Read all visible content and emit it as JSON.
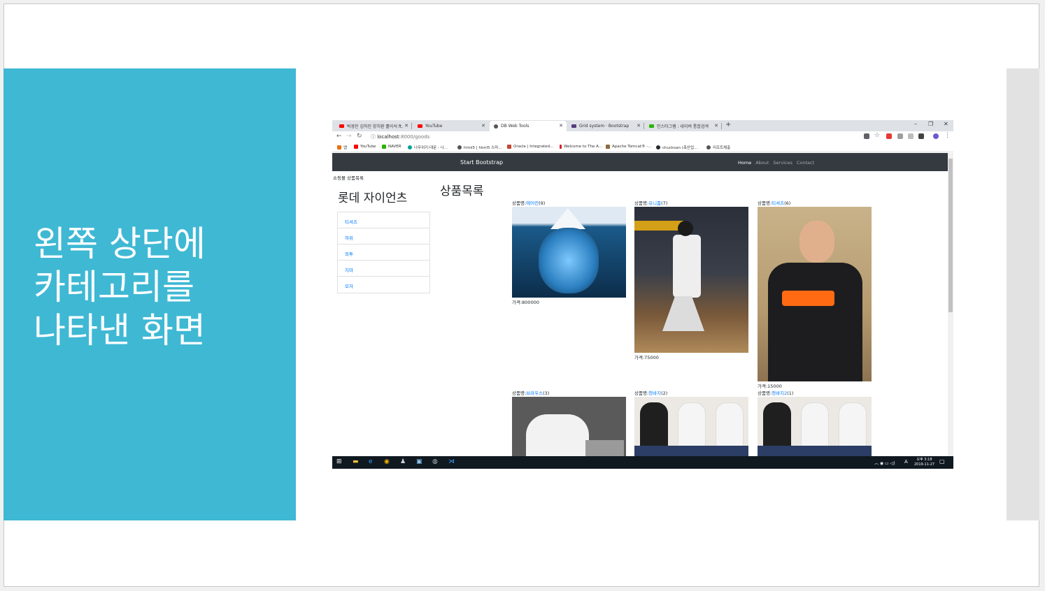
{
  "slide": {
    "title_lines": [
      "왼쪽 상단에",
      "카테고리를",
      "나타낸 화면"
    ],
    "band_color": "#3fb8d4"
  },
  "browser": {
    "tabs": [
      {
        "label": "박경진 김하진 양치환 홀이석 ft.",
        "favicon_color": "#ff0000"
      },
      {
        "label": "YouTube",
        "favicon_color": "#ff0000"
      },
      {
        "label": "DB Web Tools",
        "favicon_color": "#555555",
        "active": true
      },
      {
        "label": "Grid system · Bootstrap",
        "favicon_color": "#563d7c"
      },
      {
        "label": "인스타그램 : 네이버 통합검색",
        "favicon_color": "#2db400"
      }
    ],
    "new_tab": "+",
    "window_controls": [
      "–",
      "❐",
      "✕"
    ],
    "url_host": "localhost",
    "url_path": ":8000/goods",
    "bookmarks": [
      {
        "label": "앱",
        "color": "#e8710a"
      },
      {
        "label": "YouTube",
        "color": "#ff0000"
      },
      {
        "label": "NAVER",
        "color": "#2db400"
      },
      {
        "label": "나무위키:대문 - 나...",
        "color": "#00a495"
      },
      {
        "label": "html5 | html5 스마...",
        "color": "#555555"
      },
      {
        "label": "Oracle | Integrated...",
        "color": "#c74634"
      },
      {
        "label": "Welcome to The A...",
        "color": "#d22128"
      },
      {
        "label": "Apache Tomcat® -...",
        "color": "#8a6d3b"
      },
      {
        "label": "chucksan (축산업...",
        "color": "#24292e"
      },
      {
        "label": "리프트체출",
        "color": "#555555"
      }
    ]
  },
  "site": {
    "brand": "Start Bootstrap",
    "nav": [
      "Home",
      "About",
      "Services",
      "Contact"
    ],
    "breadcrumb": "쇼핑몰 상품목록",
    "store_title": "롯데 자이언츠",
    "categories": [
      "티셔츠",
      "하위",
      "외투",
      "지마",
      "모자"
    ],
    "section_title": "상품목록",
    "name_prefix": "상품명:",
    "price_prefix": "가격:",
    "products": [
      {
        "name": "에어컨",
        "count": "(9)",
        "price": "800000"
      },
      {
        "name": "유니폼",
        "count": "(7)",
        "price": "75000"
      },
      {
        "name": "티셔츠",
        "count": "(6)",
        "price": "15000"
      },
      {
        "name": "브라우스",
        "count": "(3)",
        "price": ""
      },
      {
        "name": "청바지",
        "count": "(2)",
        "price": ""
      },
      {
        "name": "청바지2",
        "count": "(1)",
        "price": ""
      }
    ]
  },
  "taskbar": {
    "time": "오후 3:18",
    "date": "2019-11-27",
    "tray_text": "A"
  }
}
